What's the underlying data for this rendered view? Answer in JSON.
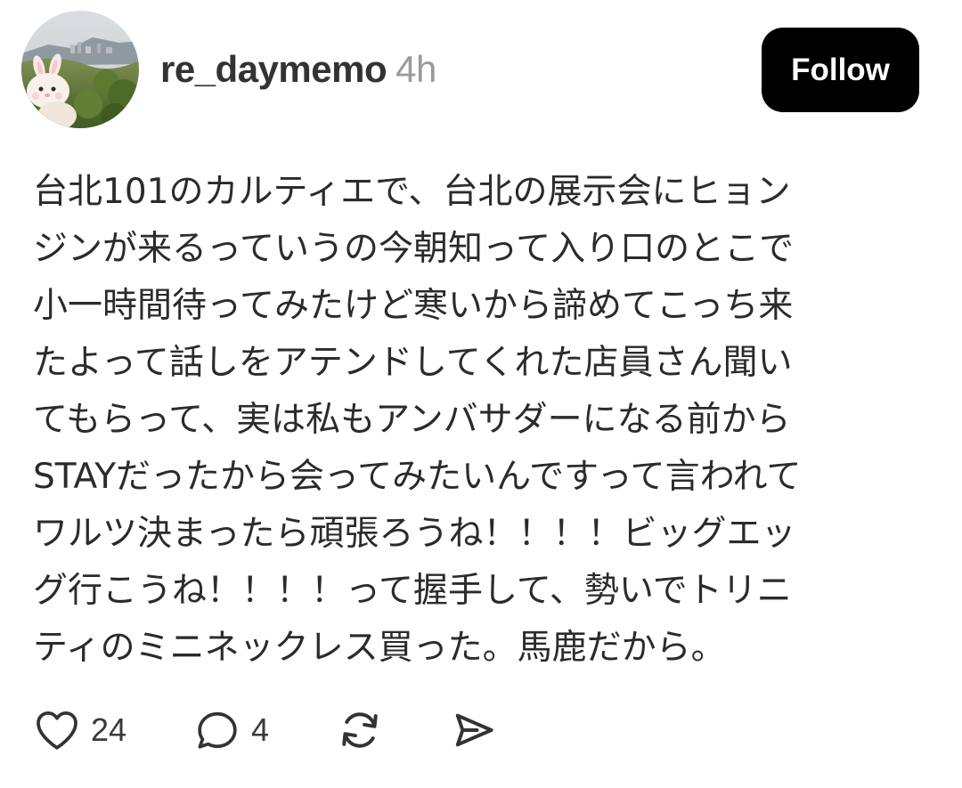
{
  "post": {
    "author": {
      "username": "re_daymemo",
      "timestamp": "4h"
    },
    "follow_label": "Follow",
    "body_lines": [
      "台北101のカルティエで、台北の展示会にヒョン",
      "ジンが来るっていうの今朝知って入り口のとこで",
      "小一時間待ってみたけど寒いから諦めてこっち来",
      "たよって話しをアテンドしてくれた店員さん聞い",
      "てもらって、実は私もアンバサダーになる前から",
      "STAYだったから会ってみたいんですって言われて",
      "ワルツ決まったら頑張ろうね！！！！ビッグエッ",
      "グ行こうね！！！！って握手して、勢いでトリニ",
      "ティのミニネックレス買った。馬鹿だから。"
    ],
    "actions": {
      "likes": {
        "icon": "heart-icon",
        "count": "24"
      },
      "replies": {
        "icon": "comment-icon",
        "count": "4"
      },
      "repost": {
        "icon": "repost-icon"
      },
      "share": {
        "icon": "send-icon"
      }
    }
  }
}
